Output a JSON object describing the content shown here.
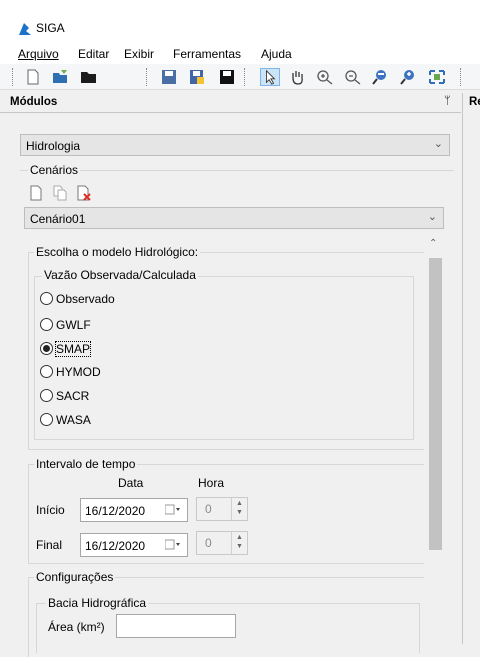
{
  "app": {
    "title": "SIGA"
  },
  "menu": [
    "Arquivo",
    "Editar",
    "Exibir",
    "Ferramentas",
    "Ajuda"
  ],
  "panel": {
    "title": "Módulos",
    "pin_glyph": "ᛘ"
  },
  "right_panel": {
    "title_fragment": "Re"
  },
  "module_select": {
    "value": "Hidrologia"
  },
  "scenarios": {
    "label": "Cenários",
    "value": "Cenário01"
  },
  "model": {
    "group_label": "Escolha o modelo Hidrológico:",
    "sub_label": "Vazão Observada/Calculada",
    "options": [
      "Observado",
      "GWLF",
      "SMAP",
      "HYMOD",
      "SACR",
      "WASA"
    ],
    "selected": "SMAP"
  },
  "interval": {
    "label": "Intervalo de tempo",
    "col_date": "Data",
    "col_hour": "Hora",
    "start_label": "Início",
    "end_label": "Final",
    "start_date": "16/12/2020",
    "end_date": "16/12/2020",
    "start_hour": "0",
    "end_hour": "0"
  },
  "config": {
    "label": "Configurações",
    "basin_label": "Bacia Hidrográfica",
    "area_label": "Área (km²)",
    "area_value": ""
  },
  "colors": {
    "accent": "#1a73c9",
    "selected_bg": "#cce4f7"
  }
}
